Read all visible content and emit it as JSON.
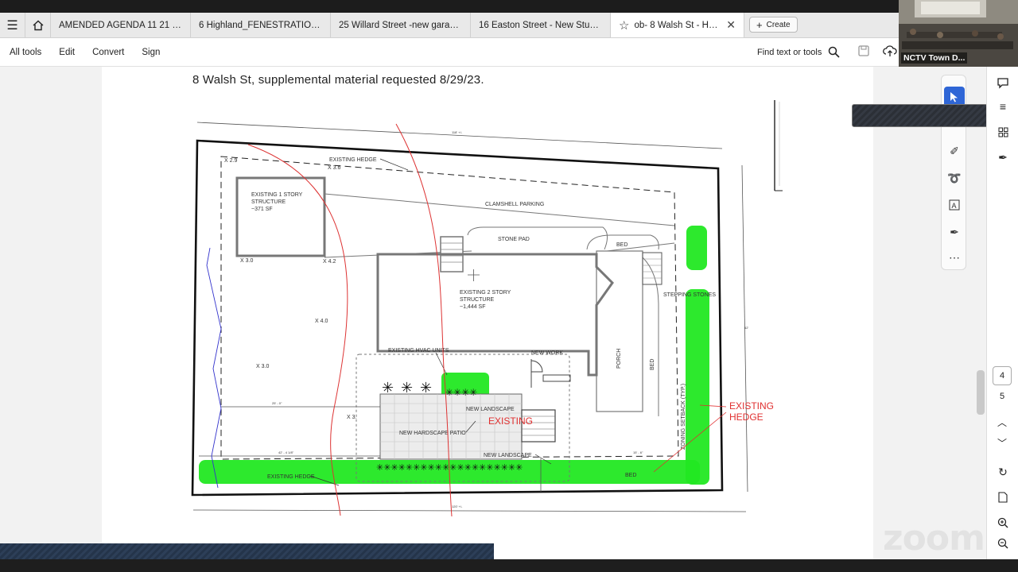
{
  "tabs": [
    {
      "label": "AMENDED AGENDA 11 21 2023.p..."
    },
    {
      "label": "6 Highland_FENESTRATION.pdf"
    },
    {
      "label": "25 Willard Street -new garage.pdf"
    },
    {
      "label": "16 Easton Street - New Studio.pdf"
    },
    {
      "label": "ob- 8 Walsh St - Hardsca..."
    }
  ],
  "create_label": "Create",
  "toolbar": {
    "all_tools": "All tools",
    "edit": "Edit",
    "convert": "Convert",
    "sign": "Sign",
    "find": "Find text or tools"
  },
  "webcam": {
    "label": "NCTV Town D..."
  },
  "document": {
    "title": "8 Walsh St, supplemental material requested 8/29/23.",
    "plan": {
      "existing_hedge_top": "EXISTING HEDGE",
      "structure_1_line1": "EXISTING 1 STORY",
      "structure_1_line2": "STRUCTURE",
      "structure_1_area": "~371 SF",
      "clamshell": "CLAMSHELL PARKING",
      "stone_pad": "STONE PAD",
      "bed_top": "BED",
      "structure_2_line1": "EXISTING 2 STORY",
      "structure_2_line2": "STRUCTURE",
      "structure_2_area": "~1,444 SF",
      "stepping_stones": "STEPPING STONES",
      "hvac": "EXISTING HVAC UNITS",
      "new_work": "NEW WORK",
      "porch": "PORCH",
      "bed_side": "BED",
      "new_landscape_1": "NEW LANDSCAPE",
      "existing_red": "EXISTING",
      "new_hardscape": "NEW HARDSCAPE PATIO",
      "new_landscape_2": "NEW LANDSCAPE",
      "existing_hedge_bottom": "EXISTING HEDGE",
      "bed_bottom": "BED",
      "zoning": "ZONING SETBACK (TYP.)",
      "existing_hedge_red_1": "EXISTING",
      "existing_hedge_red_2": "HEDGE",
      "x29": "X 2.9",
      "x36": "X 3.6",
      "x30a": "X 3.0",
      "x42": "X 4.2",
      "x40": "X 4.0",
      "x30b": "X 3.0",
      "x3x": "X 3.",
      "dim_top": "118' +/-",
      "dim_bottom": "120' +/-",
      "dim_right": "62'",
      "dim_setback": "25' - 0\"",
      "dim_left_bottom": "42' - 4 1/8\"",
      "dim_right_bottom": "15' - 6\""
    }
  },
  "page_nav": {
    "current": "4",
    "next": "5"
  },
  "watermark": "zoom",
  "colors": {
    "hedge_green": "#22e822",
    "red_annotation": "#e03030",
    "rail_active": "#2f66d6"
  }
}
